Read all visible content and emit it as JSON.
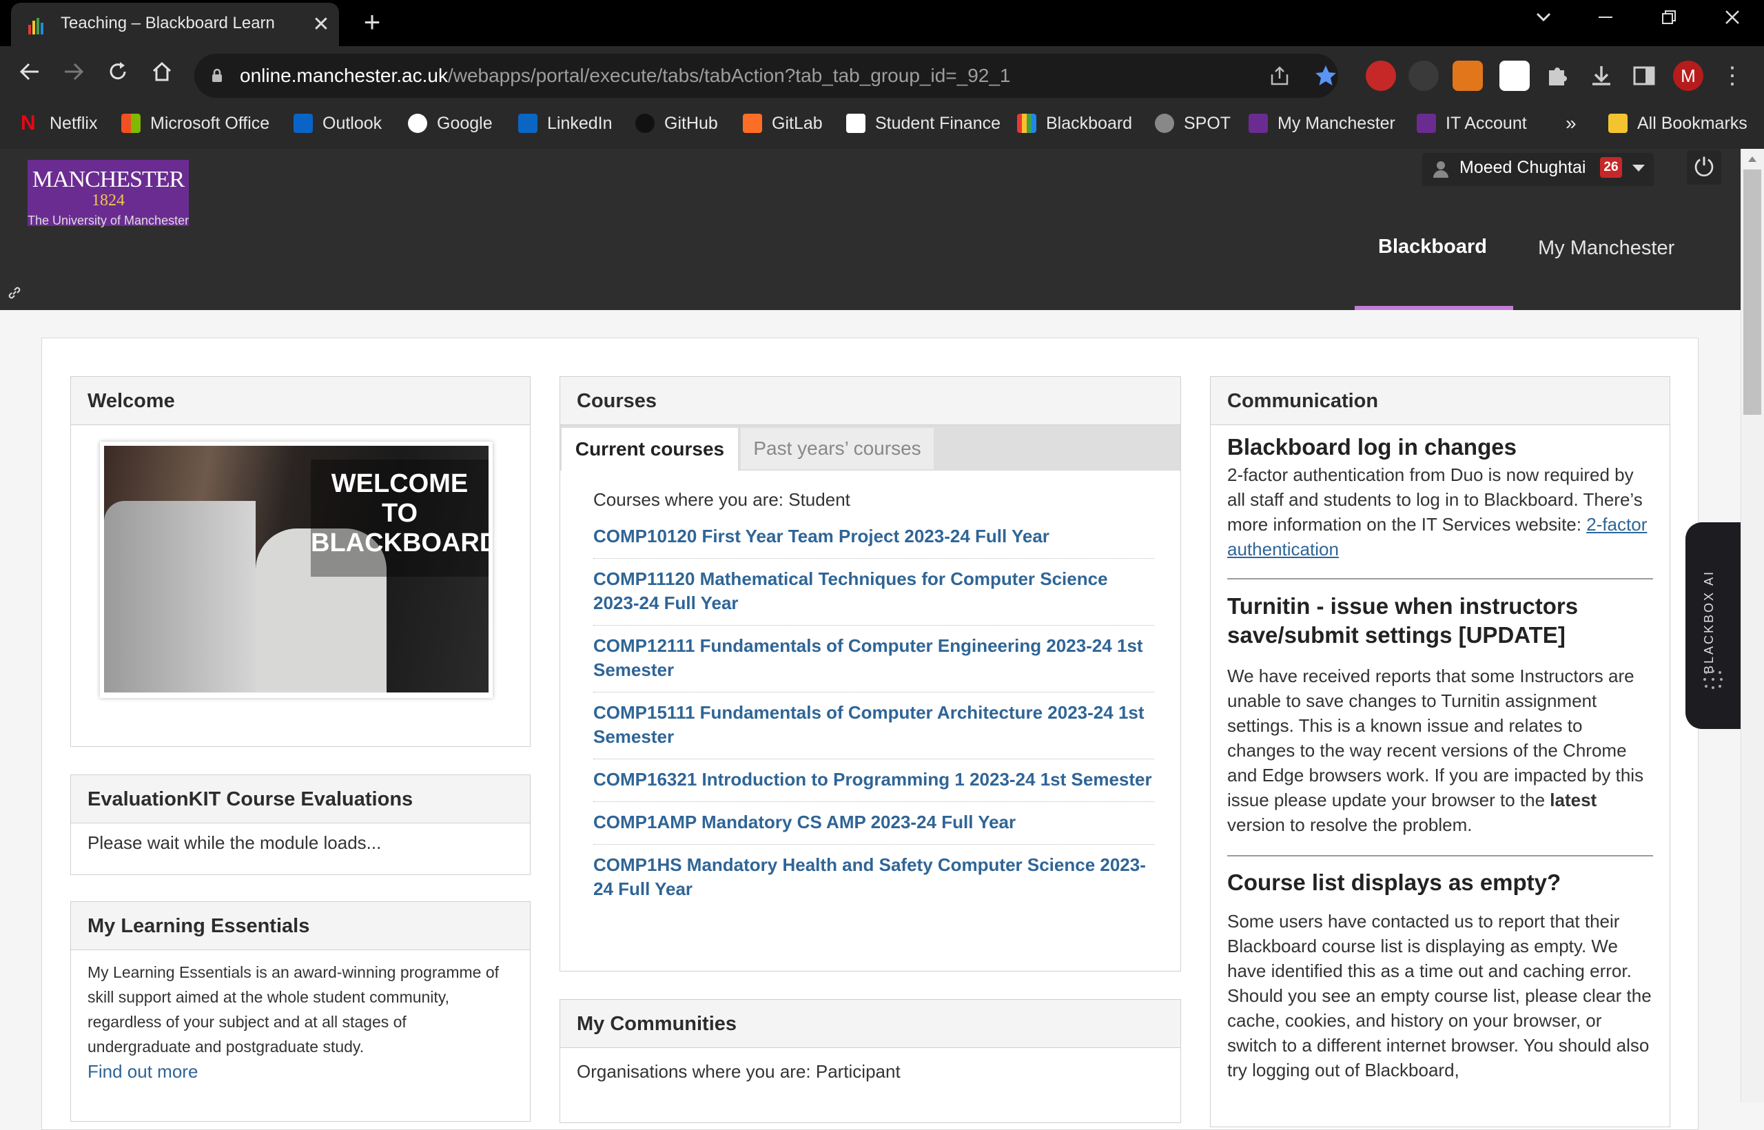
{
  "browser": {
    "tab_title": "Teaching – Blackboard Learn",
    "url_host": "online.manchester.ac.uk",
    "url_path": "/webapps/portal/execute/tabs/tabAction?tab_tab_group_id=_92_1",
    "profile_initial": "M",
    "bookmarks": [
      {
        "label": "Netflix",
        "color": "#e50914"
      },
      {
        "label": "Microsoft Office",
        "color": "#f25022"
      },
      {
        "label": "Outlook",
        "color": "#0a64c8"
      },
      {
        "label": "Google",
        "color": "#ffffff"
      },
      {
        "label": "LinkedIn",
        "color": "#0a66c2"
      },
      {
        "label": "GitHub",
        "color": "#1b1b1b"
      },
      {
        "label": "GitLab",
        "color": "#fc6d26"
      },
      {
        "label": "Student Finance",
        "color": "#ffffff"
      },
      {
        "label": "Blackboard",
        "color": "#f5b400"
      },
      {
        "label": "SPOT",
        "color": "#888888"
      },
      {
        "label": "My Manchester",
        "color": "#6b2c91"
      },
      {
        "label": "IT Account",
        "color": "#6b2c91"
      }
    ],
    "overflow": "»",
    "all_bookmarks": "All Bookmarks"
  },
  "header": {
    "logo_name": "MANCHESTER",
    "logo_year": "1824",
    "logo_sub": "The University of Manchester",
    "user_name": "Moeed Chughtai",
    "notification_count": "26",
    "nav": [
      "Blackboard",
      "My Manchester"
    ]
  },
  "welcome": {
    "title": "Welcome",
    "image_text": [
      "WELCOME",
      "TO",
      "BLACKBOARD"
    ]
  },
  "evalkit": {
    "title": "EvaluationKIT Course Evaluations",
    "message": "Please wait while the module loads..."
  },
  "mle": {
    "title": "My Learning Essentials",
    "text": "My Learning Essentials is an award-winning programme of skill support aimed at the whole student community, regardless of your subject and at all stages of undergraduate and postgraduate study.",
    "link": "Find out more"
  },
  "courses": {
    "title": "Courses",
    "tabs": [
      "Current courses",
      "Past years’ courses"
    ],
    "role_line": "Courses where you are: Student",
    "items": [
      "COMP10120 First Year Team Project 2023-24 Full Year",
      "COMP11120 Mathematical Techniques for Computer Science 2023-24 Full Year",
      "COMP12111 Fundamentals of Computer Engineering 2023-24 1st Semester",
      "COMP15111 Fundamentals of Computer Architecture 2023-24 1st Semester",
      "COMP16321 Introduction to Programming 1 2023-24 1st Semester",
      "COMP1AMP Mandatory CS AMP 2023-24 Full Year",
      "COMP1HS Mandatory Health and Safety Computer Science 2023-24 Full Year"
    ]
  },
  "communities": {
    "title": "My Communities",
    "role_line": "Organisations where you are: Participant"
  },
  "communication": {
    "title": "Communication",
    "a1_title": "Blackboard log in changes",
    "a1_text": "2-factor authentication from Duo is now required by all staff and students to log in to Blackboard. There’s more information on the IT Services website: ",
    "a1_link": "2-factor authentication",
    "a2_title": "Turnitin - issue when instructors save/submit settings [UPDATE]",
    "a2_text_before": "We have received reports that some Instructors are unable to save changes to Turnitin assignment settings. This is a known issue and relates to changes to the way recent versions of the Chrome and Edge browsers work. If you are impacted by this issue please update your browser to the ",
    "a2_bold": "latest",
    "a2_text_after": " version to resolve the problem.",
    "a3_title": "Course list displays as empty?",
    "a3_text": "Some users have contacted us to report that their Blackboard course list is displaying as empty.  We have identified this as a time out and caching error.  Should you see an empty course list, please clear the cache, cookies, and history on your browser, or switch to a different internet browser. You should also try logging out of Blackboard,"
  },
  "blackbox": {
    "label": "BLACKBOX AI"
  }
}
